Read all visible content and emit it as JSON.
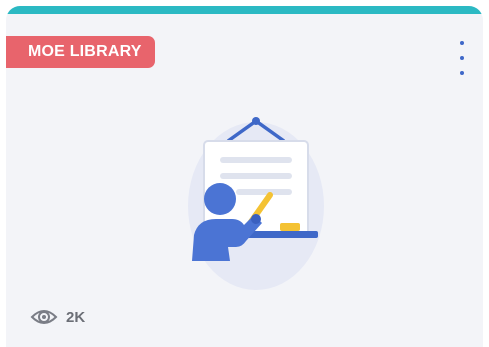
{
  "card": {
    "badge_label": "MOE LIBRARY",
    "views_count": "2K",
    "icons": {
      "menu": "more-vertical-icon",
      "views": "eye-icon",
      "illustration": "teacher-whiteboard-icon"
    },
    "colors": {
      "top_bar": "#2bb9c3",
      "badge_bg": "#e8646c",
      "menu_dots": "#3f68c8",
      "card_bg": "#f3f4f8"
    }
  }
}
